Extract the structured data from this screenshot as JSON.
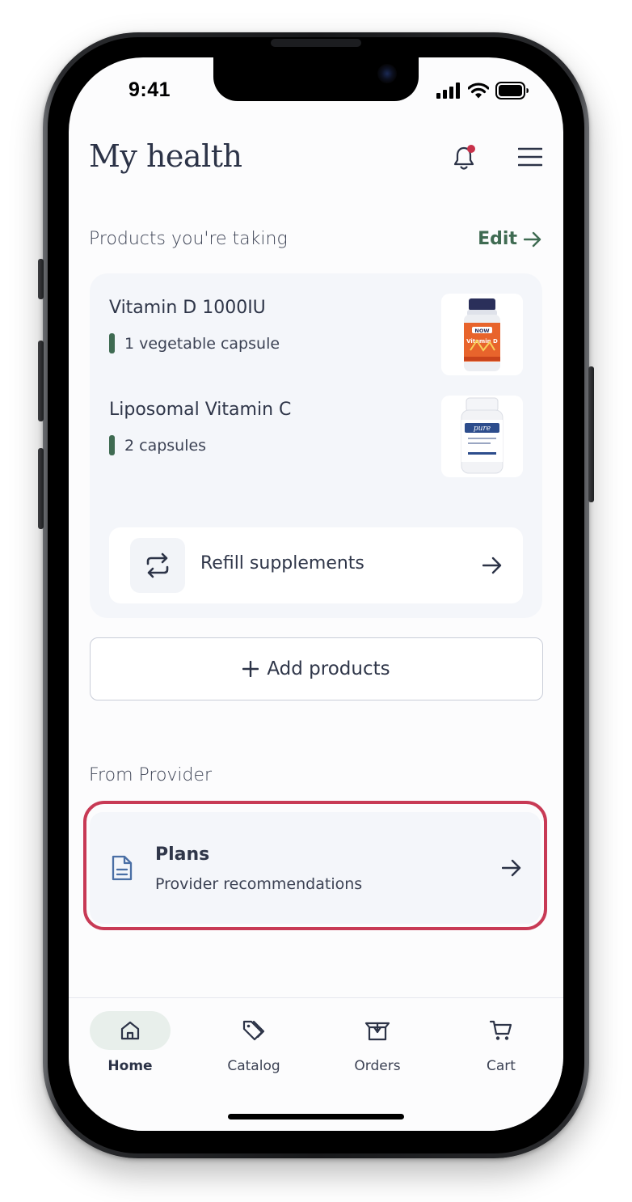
{
  "status_bar": {
    "time": "9:41"
  },
  "header": {
    "title": "My health"
  },
  "products_section": {
    "label": "Products you're taking",
    "edit_label": "Edit",
    "products": [
      {
        "name": "Vitamin D 1000IU",
        "dose": "1 vegetable capsule",
        "image_brand": "NOW",
        "image_label": "Vitamin D"
      },
      {
        "name": "Liposomal Vitamin C",
        "dose": "2 capsules",
        "image_brand": "pure",
        "image_label": ""
      }
    ],
    "refill_label": "Refill supplements",
    "add_label": "Add products"
  },
  "provider_section": {
    "label": "From Provider",
    "plans_title": "Plans",
    "plans_subtitle": "Provider recommendations"
  },
  "tabbar": {
    "tabs": [
      {
        "label": "Home",
        "icon": "home-icon",
        "active": true
      },
      {
        "label": "Catalog",
        "icon": "tag-icon",
        "active": false
      },
      {
        "label": "Orders",
        "icon": "box-icon",
        "active": false
      },
      {
        "label": "Cart",
        "icon": "cart-icon",
        "active": false
      }
    ]
  },
  "colors": {
    "accent_green": "#3f6b52",
    "notification_dot": "#c8314a",
    "highlight_border": "#c83a55",
    "card_bg": "#f4f6fa",
    "text": "#2c3347"
  }
}
